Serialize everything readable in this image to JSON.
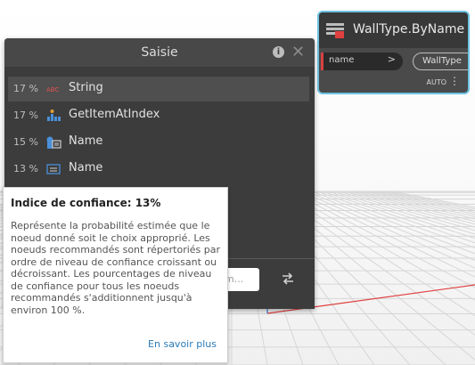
{
  "node": {
    "title": "WallType.ByName",
    "input_port": "name",
    "input_arrow": ">",
    "output_port": "WallType",
    "lacing": "AUTO",
    "menu_glyph": "⋮",
    "accent_color": "#6ec1e4",
    "port_color": "#d94040"
  },
  "search_panel": {
    "title": "Saisie",
    "info_glyph": "i",
    "close_glyph": "✕",
    "results": [
      {
        "percent": "17 %",
        "icon": "abc-string-icon",
        "name": "String",
        "selected": true
      },
      {
        "percent": "17 %",
        "icon": "list-get-item-icon",
        "name": "GetItemAtIndex",
        "selected": false
      },
      {
        "percent": "15 %",
        "icon": "element-name-icon",
        "name": "Name",
        "selected": false
      },
      {
        "percent": "13 %",
        "icon": "wall-type-name-icon",
        "name": "Name",
        "selected": false
      }
    ],
    "search_placeholder": "tom..."
  },
  "tooltip": {
    "title": "Indice  de confiance: 13%",
    "body": "Représente la probabilité estimée que le noeud donné soit le choix approprié. Les noeuds recommandés sont répertoriés par ordre de niveau de confiance croissant ou décroissant. Les pourcentages de niveau de confiance pour tous les noeuds recommandés s'additionnent jusqu'à environ 100 %.",
    "link": "En savoir plus"
  }
}
